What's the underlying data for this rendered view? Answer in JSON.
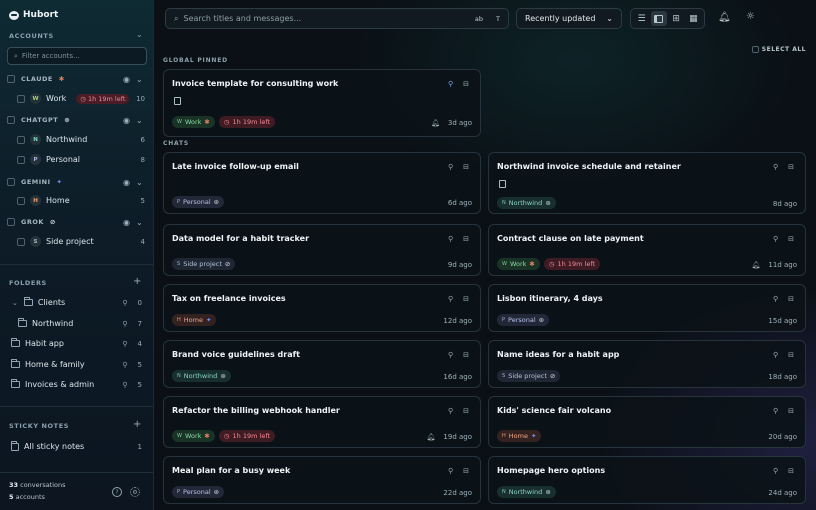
{
  "app": {
    "name": "Hubort"
  },
  "sidebar": {
    "accounts_label": "ACCOUNTS",
    "filter_placeholder": "Filter accounts...",
    "providers": [
      {
        "name": "CLAUDE",
        "badge": "✱",
        "accounts": [
          {
            "initial": "W",
            "name": "Work",
            "timer": "1h 19m left",
            "count": "10"
          }
        ]
      },
      {
        "name": "CHATGPT",
        "badge": "⊛",
        "accounts": [
          {
            "initial": "N",
            "name": "Northwind",
            "count": "6"
          },
          {
            "initial": "P",
            "name": "Personal",
            "count": "8"
          }
        ]
      },
      {
        "name": "GEMINI",
        "badge": "✦",
        "accounts": [
          {
            "initial": "H",
            "name": "Home",
            "count": "5"
          }
        ]
      },
      {
        "name": "GROK",
        "badge": "⊘",
        "accounts": [
          {
            "initial": "S",
            "name": "Side project",
            "count": "4"
          }
        ]
      }
    ],
    "folders_label": "FOLDERS",
    "folders": [
      {
        "name": "Clients",
        "count": "0"
      },
      {
        "name": "Northwind",
        "count": "7"
      },
      {
        "name": "Habit app",
        "count": "4"
      },
      {
        "name": "Home & family",
        "count": "5"
      },
      {
        "name": "Invoices & admin",
        "count": "5"
      }
    ],
    "sticky_label": "STICKY NOTES",
    "sticky_item": {
      "name": "All sticky notes",
      "count": "1"
    },
    "footer": {
      "conversations_count": "33",
      "conversations_label": "conversations",
      "accounts_count": "5",
      "accounts_label": "accounts"
    }
  },
  "toolbar": {
    "search_placeholder": "Search titles and messages...",
    "opt_case": "ab",
    "opt_title": "T",
    "sort_label": "Recently updated",
    "select_all": "SELECT ALL"
  },
  "groups": {
    "pinned_label": "GLOBAL PINNED",
    "chats_label": "CHATS"
  },
  "pinned": [
    {
      "title": "Invoice template for consulting work",
      "tag": "Work",
      "tag_icon": "✱",
      "timer": "1h 19m left",
      "date": "3d ago"
    }
  ],
  "chats": [
    {
      "title": "Late invoice follow-up email",
      "tag": "Personal",
      "tag_icon": "⊛",
      "date": "6d ago"
    },
    {
      "title": "Northwind invoice schedule and retainer",
      "tag": "Northwind",
      "tag_icon": "⊛",
      "date": "8d ago"
    },
    {
      "title": "Data model for a habit tracker",
      "tag": "Side project",
      "tag_icon": "⊘",
      "date": "9d ago"
    },
    {
      "title": "Contract clause on late payment",
      "tag": "Work",
      "tag_icon": "✱",
      "timer": "1h 19m left",
      "date": "11d ago"
    },
    {
      "title": "Tax on freelance invoices",
      "tag": "Home",
      "tag_icon": "✦",
      "date": "12d ago"
    },
    {
      "title": "Lisbon itinerary, 4 days",
      "tag": "Personal",
      "tag_icon": "⊛",
      "date": "15d ago"
    },
    {
      "title": "Brand voice guidelines draft",
      "tag": "Northwind",
      "tag_icon": "⊛",
      "date": "16d ago"
    },
    {
      "title": "Name ideas for a habit app",
      "tag": "Side project",
      "tag_icon": "⊘",
      "date": "18d ago"
    },
    {
      "title": "Refactor the billing webhook handler",
      "tag": "Work",
      "tag_icon": "✱",
      "timer": "1h 19m left",
      "date": "19d ago"
    },
    {
      "title": "Kids' science fair volcano",
      "tag": "Home",
      "tag_icon": "✦",
      "date": "20d ago"
    },
    {
      "title": "Meal plan for a busy week",
      "tag": "Personal",
      "tag_icon": "⊛",
      "date": "22d ago"
    },
    {
      "title": "Homepage hero options",
      "tag": "Northwind",
      "tag_icon": "⊛",
      "date": "24d ago"
    }
  ],
  "icons": {
    "accent": "#8ed6a4",
    "timer_color": "#f08a96"
  }
}
